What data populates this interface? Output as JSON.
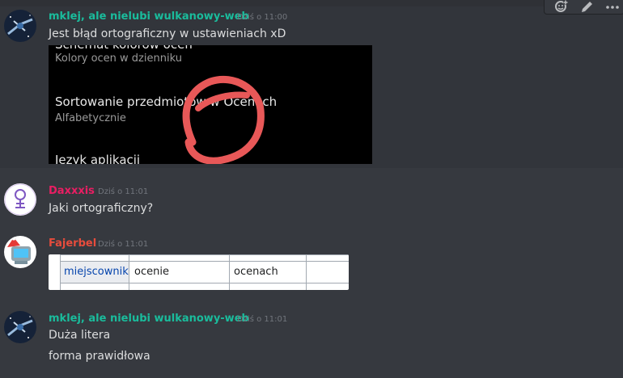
{
  "messages": [
    {
      "username": "mklej, ale nielubi wulkanowy-web",
      "timestamp": "Dziś o 11:00",
      "text": "Jest błąd ortograficzny w ustawieniach xD",
      "embed": {
        "partial_top": "Schemat kolorów ocen",
        "item1_subtitle": "Kolory ocen w dzienniku",
        "item2_title": "Sortowanie przedmiotów w Ocenach",
        "item2_subtitle": "Alfabetycznie",
        "item3_title": "Język aplikacji"
      }
    },
    {
      "username": "Daxxxis",
      "timestamp": "Dziś o 11:01",
      "text": "Jaki ortograficzny?"
    },
    {
      "username": "Fajerbel",
      "timestamp": "Dziś o 11:01",
      "table": {
        "case": "miejscownik",
        "singular": "ocenie",
        "plural": "ocenach"
      }
    },
    {
      "username": "mklej, ale nielubi wulkanowy-web",
      "timestamp": "Dziś o 11:01",
      "text": "Duża litera",
      "text2": "forma prawidłowa"
    }
  ],
  "colors": {
    "mklej": "#1abc9c",
    "daxxxis": "#e91e63",
    "fajerbel": "#e74c3c"
  },
  "icons": [
    "add-reaction-icon",
    "edit-icon",
    "more-icon"
  ]
}
